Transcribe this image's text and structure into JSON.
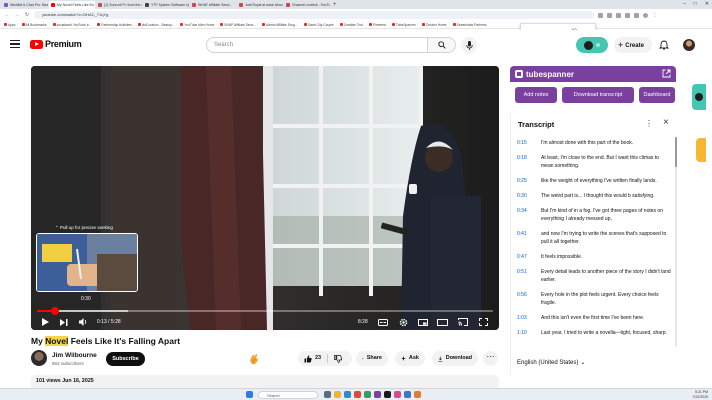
{
  "browser": {
    "tabs": [
      {
        "label": "Wishlist & Chat Pro: Beats for...",
        "color": "#6b5cc7"
      },
      {
        "label": "My Novel Feels Like It's Falling...",
        "color": "#ff0000",
        "active": true
      },
      {
        "label": "(1) Sunroof Ft. from the clients",
        "color": "#c94a4a"
      },
      {
        "label": "YTF System Software Update...",
        "color": "#444444"
      },
      {
        "label": "WHAT Affiliate Send...",
        "color": "#c94a4a"
      },
      {
        "label": "Just Royal at ease About Pro to..",
        "color": "#c94a4a"
      },
      {
        "label": "Channel content - YouTube S...",
        "color": "#c94a4a"
      }
    ],
    "url": "youtube.com/watch?v=OHAC_TJqYg",
    "bookmarks": [
      "Apps",
      "All Bookmarks",
      "socialwork YouTube tr...",
      "Partnership Activities",
      "vidCuration - Beauty...",
      "YouTube Man Home",
      "SNAP Affiliate Send...",
      "Admin Affiliate Drug...",
      "Gaea City Couple",
      "Creative Tool",
      "Pinterest",
      "TubeSpanner",
      "Creator Home",
      "Streamlabs Partners"
    ],
    "find_text": "1/0"
  },
  "header": {
    "logo_text": "Premium",
    "search_placeholder": "Search",
    "create_label": "Create"
  },
  "player": {
    "pull_tip": "Pull up for precise seeking",
    "hover_time": "0:30",
    "current_time": "0:13",
    "duration": "5:28",
    "time_display": "0:13 / 5:28",
    "caption_time": "8:28",
    "progress_played": 0.04,
    "progress_buffered": 0.2,
    "hover_position": 0.095
  },
  "video": {
    "title_pre": "My ",
    "title_highlight": "Novel",
    "title_post": " Feels Like It's Falling Apart",
    "channel_name": "Jim Wilbourne",
    "subscribers": "863 subscribers",
    "subscribe_label": "Subscribe",
    "likes": "23",
    "share_label": "Share",
    "ask_label": "Ask",
    "download_label": "Download",
    "views_date": "101 views  Jun 16, 2025"
  },
  "tubespanner": {
    "brand": "tubespanner",
    "buttons": [
      "Add notes",
      "Download transcript",
      "Dashboard"
    ],
    "accent": "#7b3fa0"
  },
  "transcript": {
    "title": "Transcript",
    "language": "English (United States)",
    "rows": [
      {
        "ts": "0:15",
        "text": "I'm almost done with this part of the book."
      },
      {
        "ts": "0:18",
        "text": "At least, I'm close to the end. But I want this climax to mean something."
      },
      {
        "ts": "0:25",
        "text": "like the weight of everything  I've written finally lands."
      },
      {
        "ts": "0:30",
        "text": "The weird part is... I thought  this would b satisfying."
      },
      {
        "ts": "0:34",
        "text": "But I'm kind of in a fog. I've got three pages  of notes on everything I already messed up,"
      },
      {
        "ts": "0:41",
        "text": "and now I'm trying to write the scenes  that's supposed to pull it all together."
      },
      {
        "ts": "0:47",
        "text": "It feels impossible."
      },
      {
        "ts": "0:51",
        "text": "Every detail leads to another piece  of the story I didn't land earlier."
      },
      {
        "ts": "0:56",
        "text": "Every hole in the plot feels urgent. Every choice feels fragile."
      },
      {
        "ts": "1:03",
        "text": "And this isn't even the first time I've been here."
      },
      {
        "ts": "1:10",
        "text": "Last year, I tried to write a  novella—tight, focused, sharp."
      }
    ]
  },
  "taskbar": {
    "search_placeholder": "Search",
    "clock_time": "5:21 PM",
    "clock_date": "7/22/2025"
  }
}
